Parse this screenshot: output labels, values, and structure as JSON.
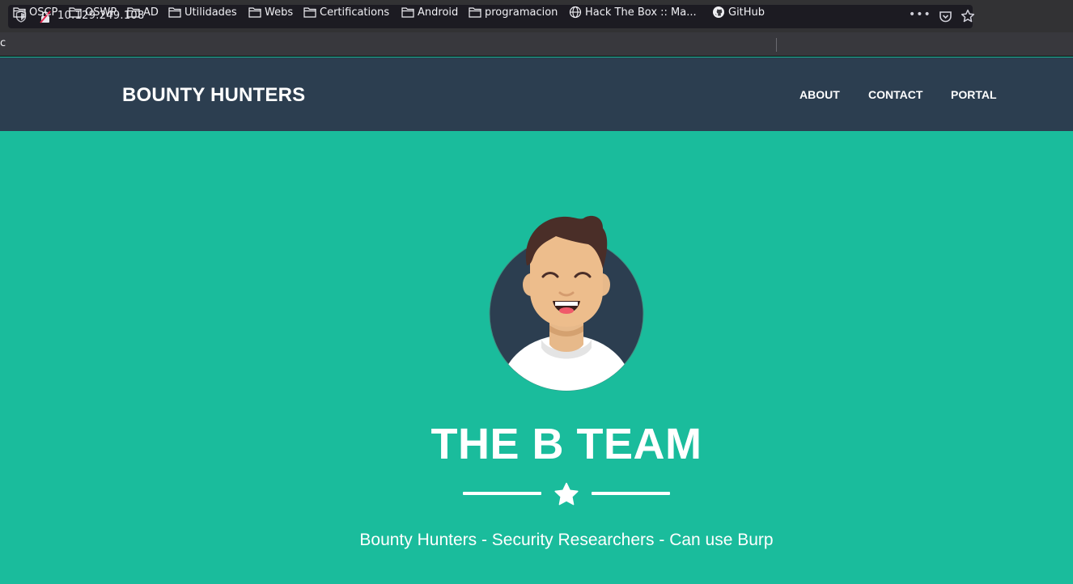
{
  "browser": {
    "url": "10.129.249.108",
    "bookmarks_edge_char": "c",
    "bookmarks": [
      {
        "label": "OSCP",
        "icon": "folder-icon"
      },
      {
        "label": "OSWP",
        "icon": "folder-icon"
      },
      {
        "label": "AD",
        "icon": "folder-icon"
      },
      {
        "label": "Utilidades",
        "icon": "folder-icon"
      },
      {
        "label": "Webs",
        "icon": "folder-icon"
      },
      {
        "label": "Certifications",
        "icon": "folder-icon"
      },
      {
        "label": "Android",
        "icon": "folder-icon"
      },
      {
        "label": "programacion",
        "icon": "folder-icon"
      },
      {
        "label": "Hack The Box :: Ma...",
        "icon": "globe-icon"
      },
      {
        "label": "GitHub",
        "icon": "github-icon"
      }
    ],
    "page_actions_icon": "more-dots-icon",
    "pocket_icon": "pocket-icon",
    "bookmark_star_icon": "star-outline-icon",
    "tracking_icon": "shield-icon",
    "insecure_icon": "insecure-lock-icon",
    "chrome_colors": {
      "toolbar": "#38383d",
      "urlbar": "#1c1b22"
    }
  },
  "site": {
    "brand": "BOUNTY HUNTERS",
    "nav": {
      "about": "ABOUT",
      "contact": "CONTACT",
      "portal": "PORTAL"
    },
    "masthead": {
      "heading": "THE B TEAM",
      "tagline": "Bounty Hunters - Security Researchers - Can use Burp",
      "avatar_icon": "avatar-illustration",
      "divider_icon": "star-icon"
    },
    "colors": {
      "navbar": "#2c3e50",
      "masthead": "#1abc9c",
      "text": "#ffffff"
    }
  }
}
